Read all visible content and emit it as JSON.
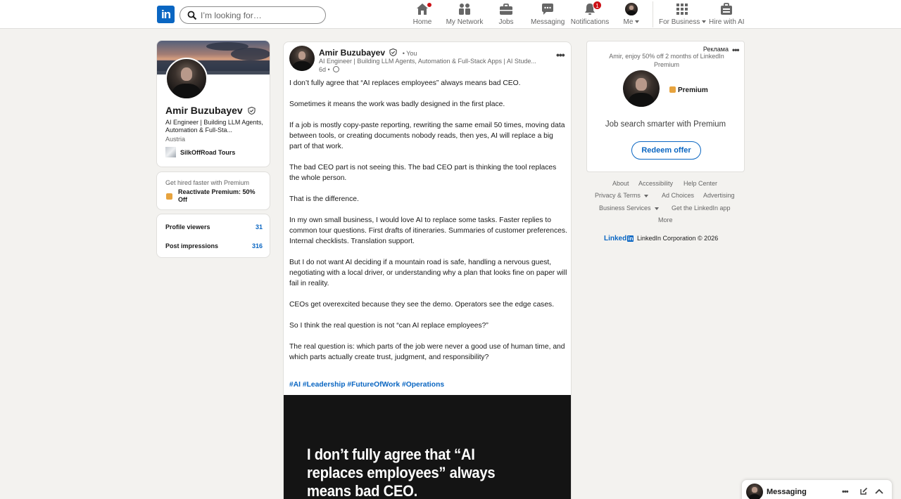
{
  "nav": {
    "logo": "in",
    "search_placeholder": "I’m looking for…",
    "items": [
      {
        "label": "Home"
      },
      {
        "label": "My Network"
      },
      {
        "label": "Jobs"
      },
      {
        "label": "Messaging"
      },
      {
        "label": "Notifications",
        "badge": "1"
      },
      {
        "label": "Me"
      },
      {
        "label": "For Business"
      },
      {
        "label": "Hire with AI"
      }
    ]
  },
  "profile": {
    "name": "Amir Buzubayev",
    "headline": "AI Engineer | Building LLM Agents, Automation & Full-Sta...",
    "location": "Austria",
    "company": "SilkOffRoad Tours"
  },
  "premium_card": {
    "line1": "Get hired faster with Premium",
    "line2": "Reactivate Premium: 50% Off"
  },
  "stats": [
    {
      "label": "Profile viewers",
      "value": "31"
    },
    {
      "label": "Post impressions",
      "value": "316"
    }
  ],
  "post": {
    "author": "Amir Buzubayev",
    "you": "• You",
    "subtitle": "AI Engineer | Building LLM Agents, Automation & Full-Stack Apps | AI Stude...",
    "time": "6d •",
    "paragraphs": [
      "I don’t fully agree that “AI replaces employees” always means bad CEO.",
      "Sometimes it means the work was badly designed in the first place.",
      "If a job is mostly copy-paste reporting, rewriting the same email 50 times, moving data between tools, or creating documents nobody reads, then yes, AI will replace a big part of that work.",
      "The bad CEO part is not seeing this. The bad CEO part is thinking the tool replaces the whole person.",
      "That is the difference.",
      "In my own small business, I would love AI to replace some tasks. Faster replies to common tour questions. First drafts of itineraries. Summaries of customer preferences. Internal checklists. Translation support.",
      "But I do not want AI deciding if a mountain road is safe, handling a nervous guest, negotiating with a local driver, or understanding why a plan that looks fine on paper will fail in reality.",
      "CEOs get overexcited because they see the demo. Operators see the edge cases.",
      "So I think the real question is not “can AI replace employees?”",
      "The real question is: which parts of the job were never a good use of human time, and which parts actually create trust, judgment, and responsibility?"
    ],
    "hashtags": "#AI #Leadership #FutureOfWork #Operations",
    "image_text": "I don’t fully agree that “AI replaces employees” always means bad CEO."
  },
  "ad": {
    "label": "Реклама",
    "text": "Amir, enjoy 50% off 2 months of LinkedIn Premium",
    "premium": "Premium",
    "tagline": "Job search smarter with Premium",
    "button": "Redeem offer"
  },
  "footer": {
    "about": "About",
    "accessibility": "Accessibility",
    "help": "Help Center",
    "privacy": "Privacy & Terms",
    "adchoices": "Ad Choices",
    "advertising": "Advertising",
    "business": "Business Services",
    "getapp": "Get the LinkedIn app",
    "more": "More",
    "brand": "Linked",
    "brand_in": "in",
    "copyright": "LinkedIn Corporation © 2026"
  },
  "messaging": {
    "label": "Messaging"
  },
  "colors": {
    "brand": "#0a66c2",
    "badge": "#cc1016",
    "premium_gold": "#e7a33e",
    "background": "#f3f2ef"
  }
}
